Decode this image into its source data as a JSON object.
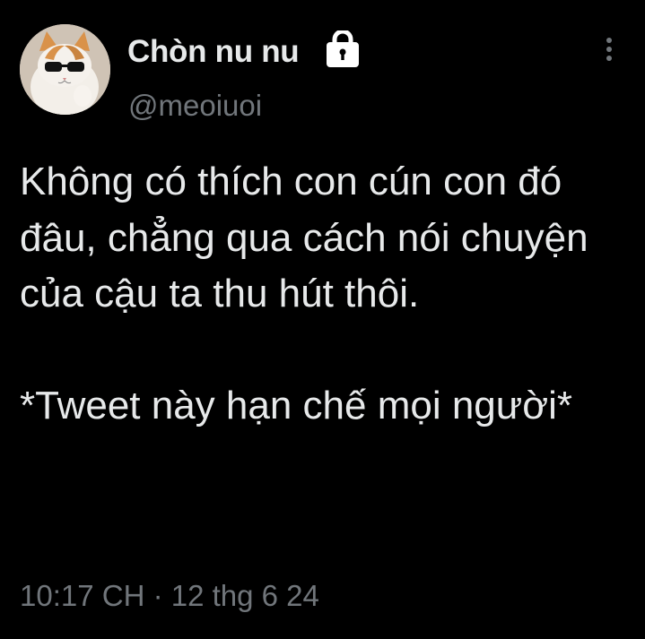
{
  "author": {
    "display_name": "Chòn nu nu",
    "handle": "@meoiuoi",
    "protected_icon": "lock-icon",
    "avatar_icon": "cat-with-sunglasses"
  },
  "menu": {
    "icon": "more-vertical-icon"
  },
  "tweet": {
    "paragraph_1": "Không có thích con cún con đó đâu, chẳng qua cách nói chuyện của cậu ta thu hút thôi.",
    "paragraph_2": "*Tweet này hạn chế mọi người*"
  },
  "meta": {
    "timestamp": "10:17 CH · 12 thg 6 24"
  },
  "colors": {
    "background": "#000000",
    "primary_text": "#e7e9ea",
    "secondary_text": "#71767b"
  }
}
